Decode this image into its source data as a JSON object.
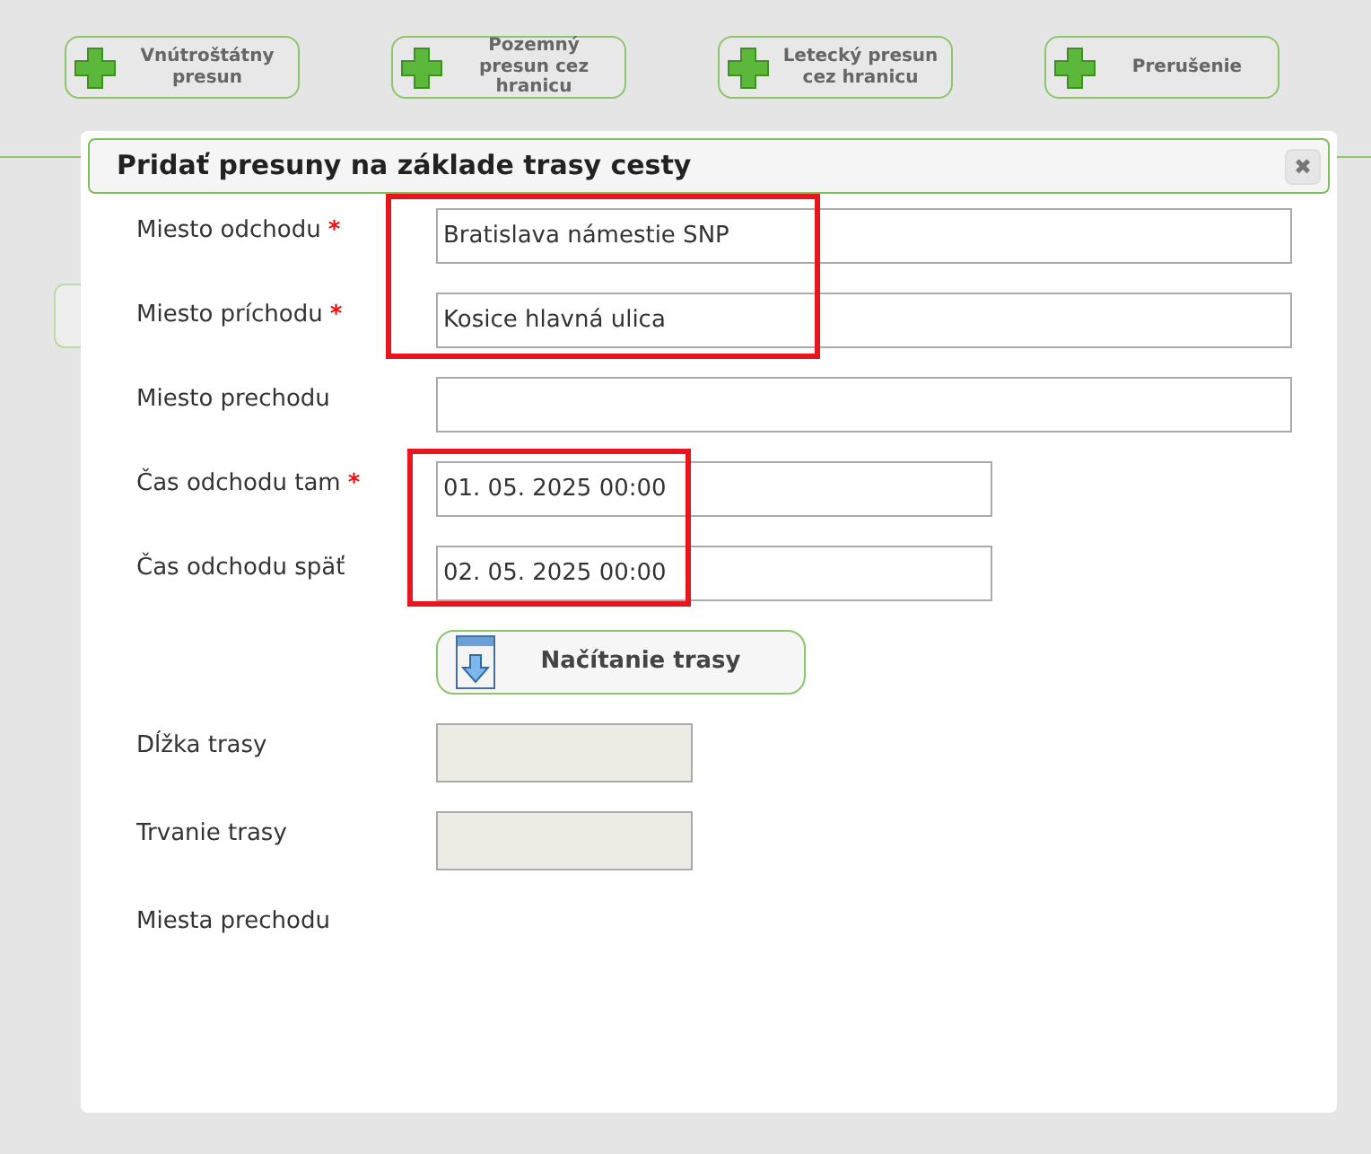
{
  "toolbar": [
    {
      "label": "Vnútroštátny presun"
    },
    {
      "label": "Pozemný presun cez hranicu"
    },
    {
      "label": "Letecký presun cez hranicu"
    },
    {
      "label": "Prerušenie"
    }
  ],
  "dialog": {
    "title": "Pridať presuny na základe trasy cesty",
    "close": "✖",
    "rows": [
      {
        "kind": "text",
        "label": "Miesto odchodu",
        "required_mark": "*",
        "value": "Bratislava námestie SNP",
        "highlighted": true
      },
      {
        "kind": "text",
        "label": "Miesto príchodu",
        "required_mark": "*",
        "value": "Kosice hlavná ulica",
        "highlighted": true
      },
      {
        "kind": "text",
        "label": "Miesto prechodu",
        "highlighted": false
      },
      {
        "kind": "datetime",
        "label": "Čas odchodu tam",
        "required_mark": "*",
        "value": "01. 05. 2025 00:00",
        "highlighted": true
      },
      {
        "kind": "datetime",
        "label": "Čas odchodu späť",
        "value": "02. 05. 2025 00:00",
        "highlighted": true
      },
      {
        "kind": "button",
        "label": "Načítanie trasy"
      },
      {
        "kind": "readonly",
        "label": "Dĺžka trasy"
      },
      {
        "kind": "readonly",
        "label": "Trvanie trasy"
      },
      {
        "kind": "plain",
        "label": "Miesta prechodu"
      }
    ]
  }
}
